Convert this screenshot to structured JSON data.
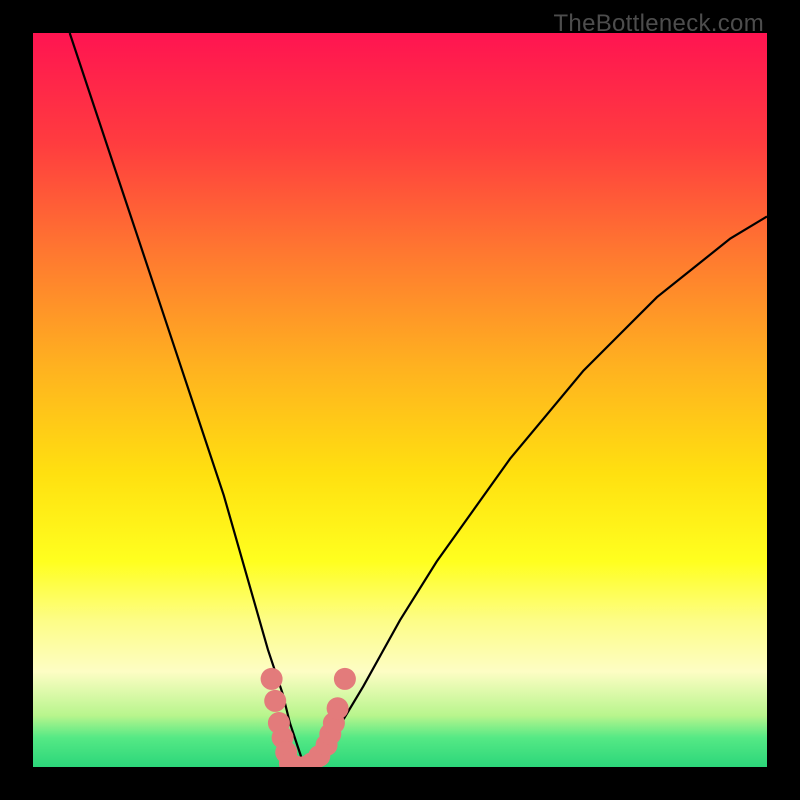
{
  "watermark": "TheBottleneck.com",
  "chart_data": {
    "type": "line",
    "title": "",
    "xlabel": "",
    "ylabel": "",
    "xlim": [
      0,
      100
    ],
    "ylim": [
      0,
      100
    ],
    "series": [
      {
        "name": "bottleneck-curve",
        "x": [
          5,
          8,
          11,
          14,
          17,
          20,
          23,
          26,
          28,
          30,
          32,
          34,
          35,
          36,
          37,
          38,
          40,
          42,
          45,
          50,
          55,
          60,
          65,
          70,
          75,
          80,
          85,
          90,
          95,
          100
        ],
        "y": [
          100,
          91,
          82,
          73,
          64,
          55,
          46,
          37,
          30,
          23,
          16,
          10,
          6,
          3,
          0,
          0,
          3,
          6,
          11,
          20,
          28,
          35,
          42,
          48,
          54,
          59,
          64,
          68,
          72,
          75
        ]
      }
    ],
    "marker_points": {
      "name": "highlight-markers",
      "color": "#e37b7b",
      "points": [
        {
          "x": 32.5,
          "y": 12
        },
        {
          "x": 33.0,
          "y": 9
        },
        {
          "x": 33.5,
          "y": 6
        },
        {
          "x": 34.0,
          "y": 4
        },
        {
          "x": 34.5,
          "y": 2
        },
        {
          "x": 35.0,
          "y": 0.5
        },
        {
          "x": 36.0,
          "y": 0
        },
        {
          "x": 37.0,
          "y": 0
        },
        {
          "x": 38.0,
          "y": 0.5
        },
        {
          "x": 39.0,
          "y": 1.5
        },
        {
          "x": 40.0,
          "y": 3
        },
        {
          "x": 40.5,
          "y": 4.5
        },
        {
          "x": 41.0,
          "y": 6
        },
        {
          "x": 41.5,
          "y": 8
        },
        {
          "x": 42.5,
          "y": 12
        }
      ]
    },
    "gradient_stops": [
      {
        "pos": 0,
        "color": "#ff1451"
      },
      {
        "pos": 72,
        "color": "#ffff1f"
      },
      {
        "pos": 100,
        "color": "#2cd67a"
      }
    ]
  }
}
